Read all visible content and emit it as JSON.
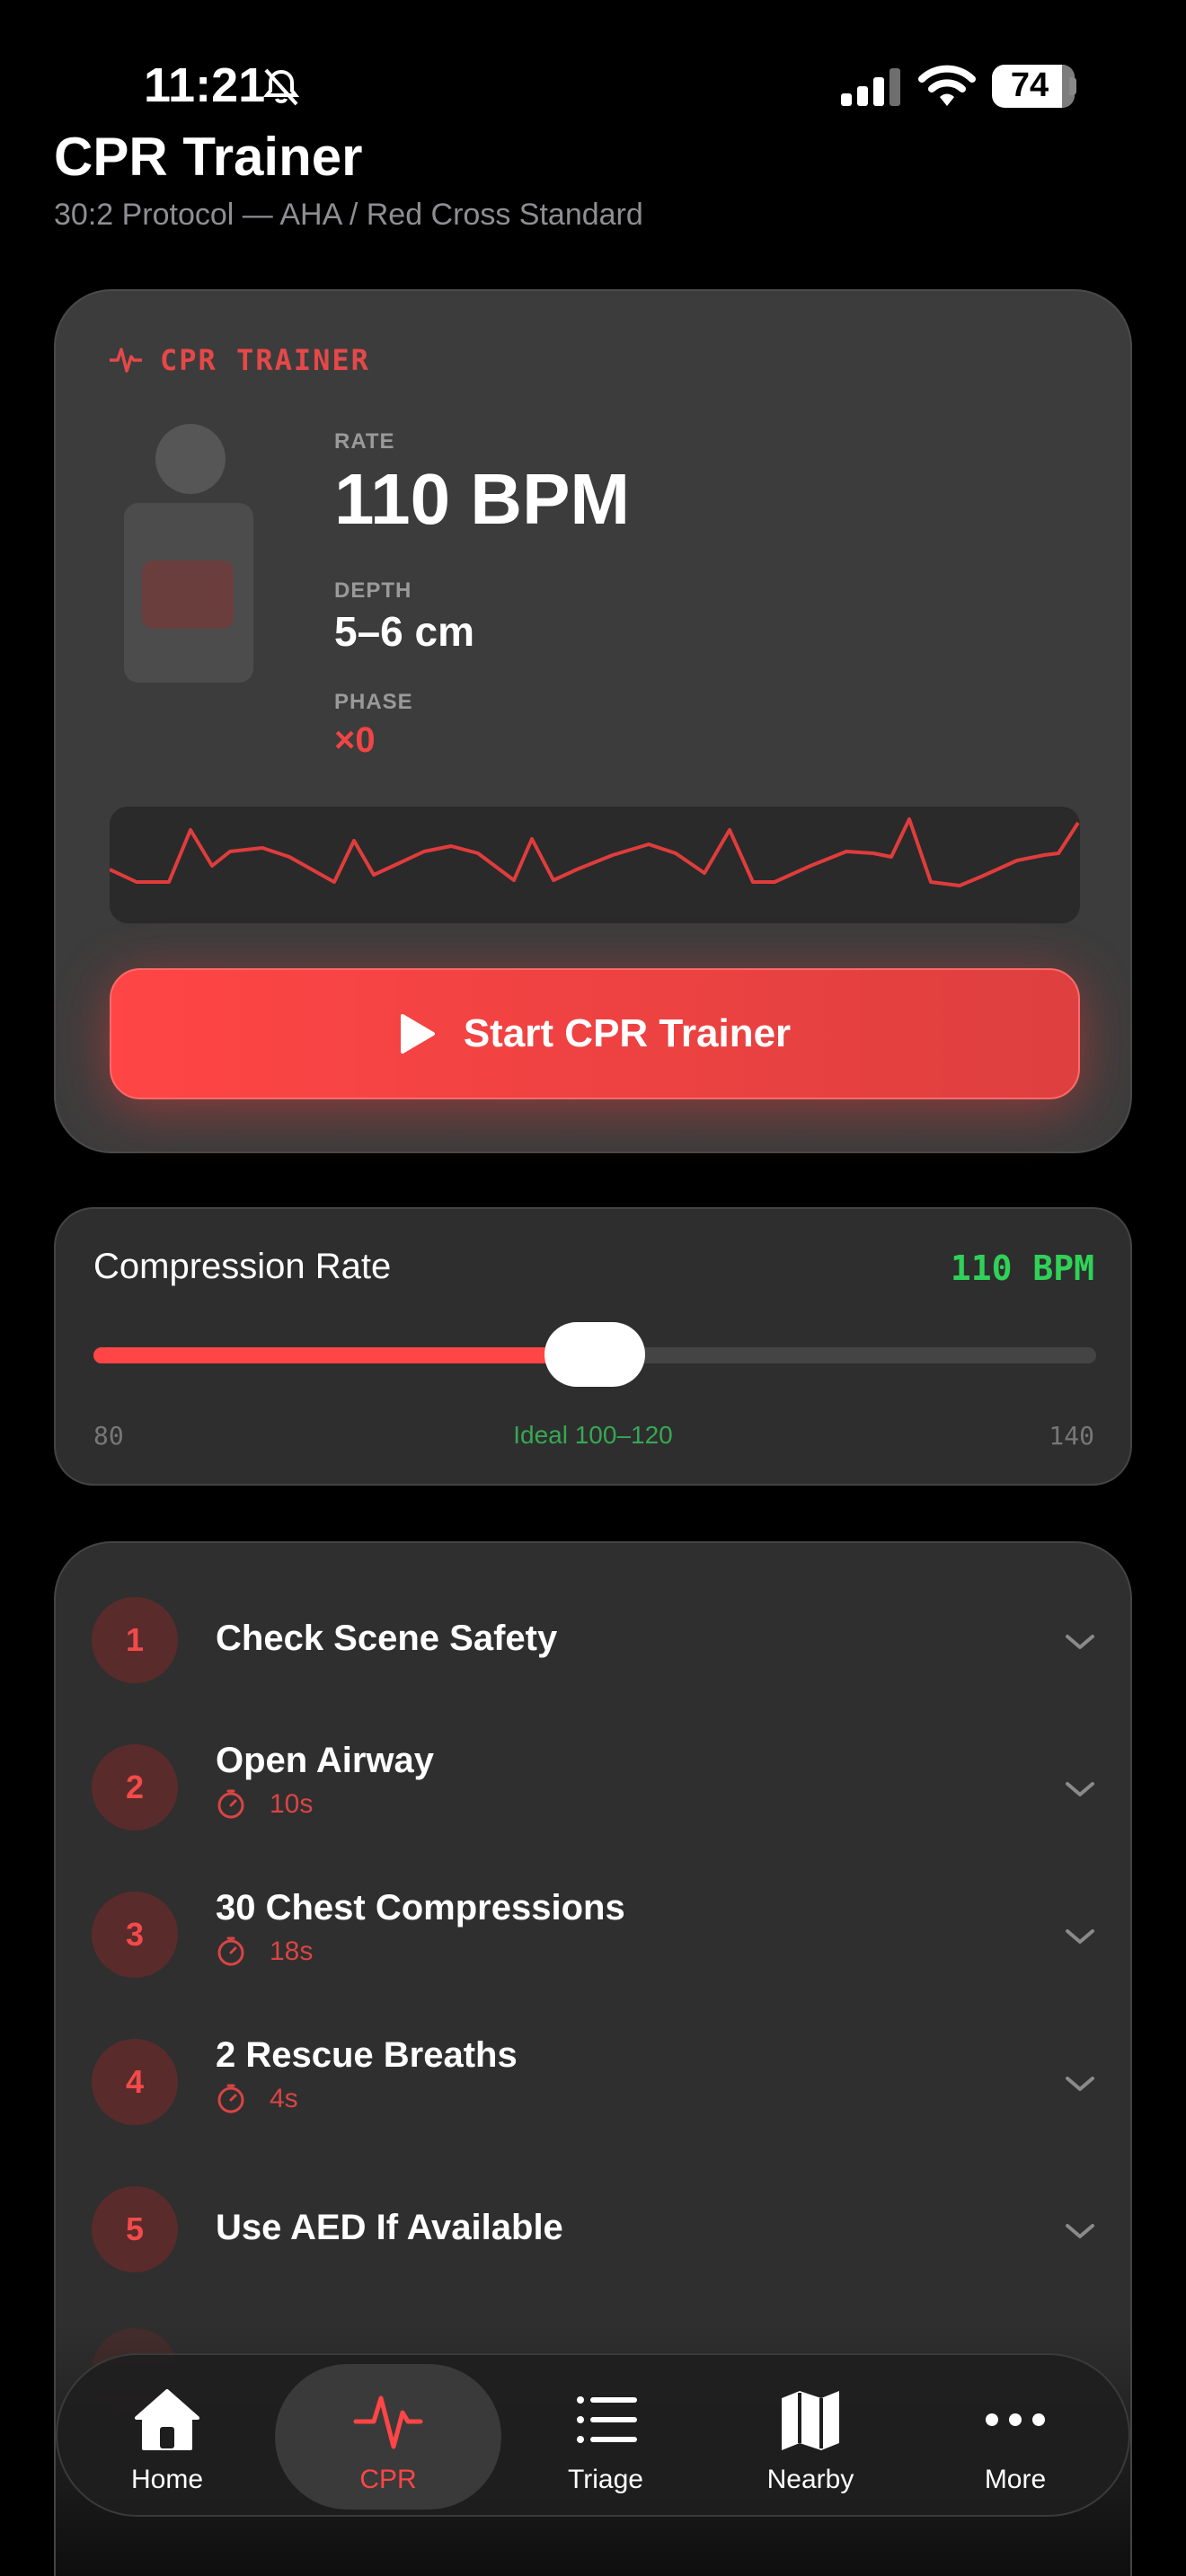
{
  "status_bar": {
    "time": "11:21",
    "battery": "74"
  },
  "header": {
    "title": "CPR Trainer",
    "subtitle": "30:2 Protocol — AHA / Red Cross Standard"
  },
  "trainer": {
    "label": "CPR TRAINER",
    "rate_label": "RATE",
    "rate_value": "110 BPM",
    "depth_label": "DEPTH",
    "depth_value": "5–6 cm",
    "phase_label": "PHASE",
    "phase_value": "×0",
    "start_label": "Start CPR Trainer",
    "accent_color": "#ff4545"
  },
  "rate": {
    "title": "Compression Rate",
    "value_label": "110 BPM",
    "value": 110,
    "min": 80,
    "max": 140,
    "min_label": "80",
    "max_label": "140",
    "ideal_label": "Ideal 100–120"
  },
  "steps": [
    {
      "num": "1",
      "title": "Check Scene Safety",
      "time": ""
    },
    {
      "num": "2",
      "title": "Open Airway",
      "time": "10s"
    },
    {
      "num": "3",
      "title": "30 Chest Compressions",
      "time": "18s"
    },
    {
      "num": "4",
      "title": "2 Rescue Breaths",
      "time": "4s"
    },
    {
      "num": "5",
      "title": "Use AED If Available",
      "time": ""
    }
  ],
  "tabs": [
    {
      "label": "Home",
      "icon": "house-icon"
    },
    {
      "label": "CPR",
      "icon": "heartbeat-icon"
    },
    {
      "label": "Triage",
      "icon": "list-icon"
    },
    {
      "label": "Nearby",
      "icon": "map-icon"
    },
    {
      "label": "More",
      "icon": "ellipsis-icon"
    }
  ]
}
